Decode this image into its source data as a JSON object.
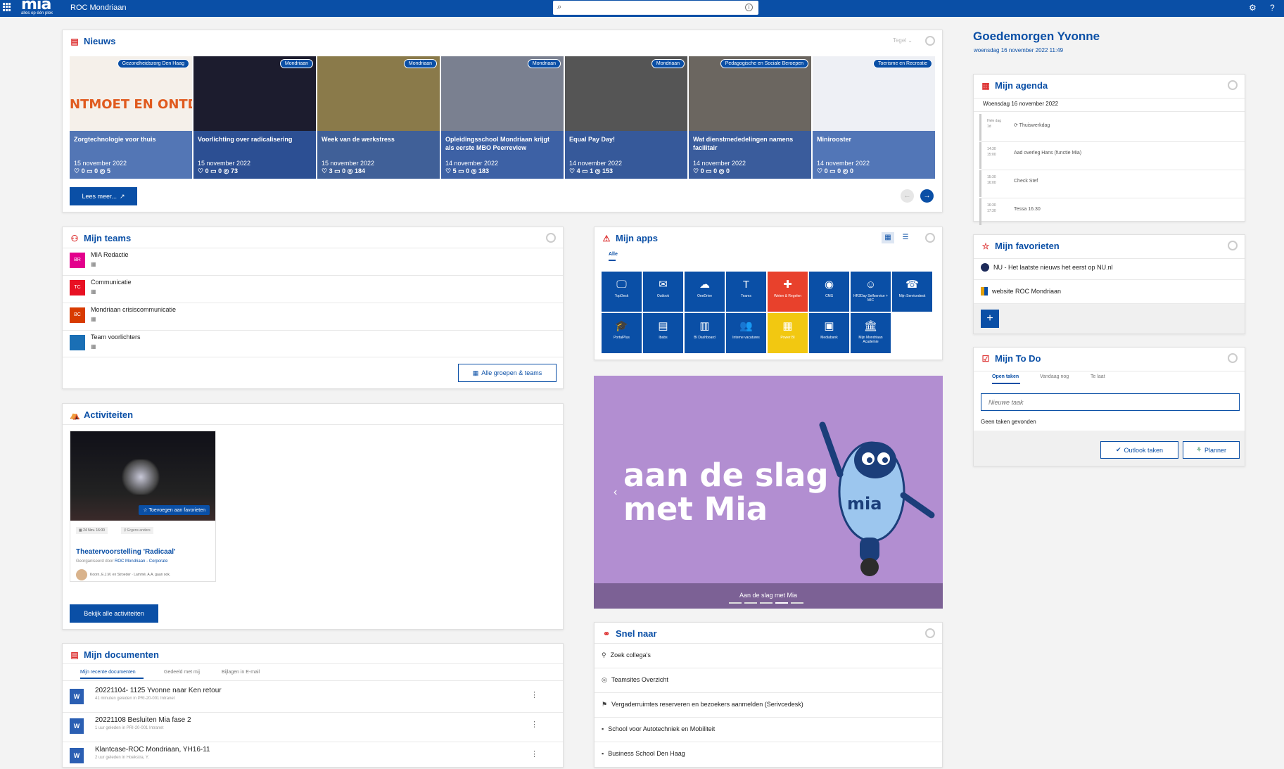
{
  "topbar": {
    "logo_text": "mia",
    "logo_sub": "alles op één plek",
    "org": "ROC Mondriaan",
    "search_placeholder": ""
  },
  "nieuws": {
    "title": "Nieuws",
    "view_label": "Tegel",
    "read_more": "Lees meer...",
    "items": [
      {
        "tag": "Gezondheidszorg Den Haag",
        "title": "Zorgtechnologie voor thuis",
        "date": "15 november 2022",
        "stats": "♡ 0 ▭ 0 ◎ 5",
        "bg": "#f5f0ea",
        "banner": "NTMOET EN ONTD"
      },
      {
        "tag": "Mondriaan",
        "title": "Voorlichting over radicalisering",
        "date": "15 november 2022",
        "stats": "♡ 0 ▭ 0 ◎ 73",
        "bg": "#1c1c2e"
      },
      {
        "tag": "Mondriaan",
        "title": "Week van de werkstress",
        "date": "15 november 2022",
        "stats": "♡ 3 ▭ 0 ◎ 184",
        "bg": "#8a7a4a"
      },
      {
        "tag": "Mondriaan",
        "title": "Opleidingsschool Mondriaan krijgt als eerste MBO Peerreview",
        "date": "14 november 2022",
        "stats": "♡ 5 ▭ 0 ◎ 183",
        "bg": "#7a8090"
      },
      {
        "tag": "Mondriaan",
        "title": "Equal Pay Day!",
        "date": "14 november 2022",
        "stats": "♡ 4 ▭ 1 ◎ 153",
        "bg": "#555555"
      },
      {
        "tag": "Pedagogische en Sociale Beroepen",
        "title": "Wat dienstmededelingen namens facilitair",
        "date": "14 november 2022",
        "stats": "♡ 0 ▭ 0 ◎ 0",
        "bg": "#6b6660"
      },
      {
        "tag": "Toerisme en Recreatie",
        "title": "Minirooster",
        "date": "14 november 2022",
        "stats": "♡ 0 ▭ 0 ◎ 0",
        "bg": "#eef0f5"
      }
    ]
  },
  "greeting": {
    "title": "Goedemorgen Yvonne",
    "date": "woensdag 16 november 2022 11:49"
  },
  "agenda": {
    "title": "Mijn agenda",
    "day": "Woensdag 16 november 2022",
    "events": [
      {
        "time": "Hele dag\n1d",
        "label": "⟳  Thuiswerkdag"
      },
      {
        "time": "14:30\n15:00",
        "label": "Aad overleg Hans (functie Mia)"
      },
      {
        "time": "15:30\n16:00",
        "label": "Check Stef"
      },
      {
        "time": "16:30\n17:30",
        "label": "Tessa 16.30"
      }
    ]
  },
  "teams": {
    "title": "Mijn teams",
    "all_button": "Alle groepen & teams",
    "items": [
      {
        "initials": "BR",
        "name": "MIA Redactie",
        "color": "#e3008c"
      },
      {
        "initials": "TC",
        "name": "Communicatie",
        "color": "#e81123"
      },
      {
        "initials": "BC",
        "name": "Mondriaan crisiscommunicatie",
        "color": "#d83b01"
      },
      {
        "initials": "",
        "name": "Team voorlichters",
        "color": "#1a6fb5"
      }
    ]
  },
  "apps": {
    "title": "Mijn apps",
    "filter": "Alle",
    "items": [
      {
        "label": "TopDesk",
        "color": "#0a4fa6",
        "icon": "🖵"
      },
      {
        "label": "Outlook",
        "color": "#0a4fa6",
        "icon": "✉"
      },
      {
        "label": "OneDrive",
        "color": "#0a4fa6",
        "icon": "☁"
      },
      {
        "label": "Teams",
        "color": "#0a4fa6",
        "icon": "T"
      },
      {
        "label": "Weten & Regelen",
        "color": "#e8412c",
        "icon": "✚"
      },
      {
        "label": "CMS",
        "color": "#0a4fa6",
        "icon": "◉"
      },
      {
        "label": "HR2Day Selfservice + MIC",
        "color": "#0a4fa6",
        "icon": "☺"
      },
      {
        "label": "Mijn Servicedesk",
        "color": "#0a4fa6",
        "icon": "☎"
      },
      {
        "label": "PortalPlus",
        "color": "#0a4fa6",
        "icon": "🎓"
      },
      {
        "label": "Ibabs",
        "color": "#0a4fa6",
        "icon": "▤"
      },
      {
        "label": "BI Dashboard",
        "color": "#0a4fa6",
        "icon": "▥"
      },
      {
        "label": "Interne vacatures",
        "color": "#0a4fa6",
        "icon": "👥"
      },
      {
        "label": "Power BI",
        "color": "#f2c811",
        "icon": "▦"
      },
      {
        "label": "Mediabank",
        "color": "#0a4fa6",
        "icon": "▣"
      },
      {
        "label": "Mijn Mondriaan Academie",
        "color": "#0a4fa6",
        "icon": "🏛"
      }
    ]
  },
  "favorieten": {
    "title": "Mijn favorieten",
    "items": [
      "NU - Het laatste nieuws het eerst op NU.nl",
      "website ROC Mondriaan"
    ]
  },
  "todo": {
    "title": "Mijn To Do",
    "tabs": [
      "Open taken",
      "Vandaag nog",
      "Te laat"
    ],
    "placeholder": "Nieuwe taak",
    "empty": "Geen taken gevonden",
    "outlook_btn": "Outlook taken",
    "planner_btn": "Planner"
  },
  "banner": {
    "headline_1": "aan de slag",
    "headline_2": "met Mia",
    "caption": "Aan de slag met Mia",
    "mascot_text": "mia"
  },
  "activiteiten": {
    "title": "Activiteiten",
    "fav_btn": "☆ Toevoegen aan favorieten",
    "date_small": "24 Nov. 16:00",
    "location": "Ergens anders",
    "event_title": "Theatervoorstelling 'Radicaal'",
    "org_prefix": "Georganiseerd door",
    "org_name": "ROC Mondriaan - Corporate",
    "attendees": "Koorn, E.J.M. en Stroeder · Lammé, A.A. gaan ook.",
    "all_btn": "Bekijk alle activiteiten"
  },
  "documenten": {
    "title": "Mijn documenten",
    "tabs": [
      "Mijn recente documenten",
      "Gedeeld met mij",
      "Bijlagen in E-mail"
    ],
    "items": [
      {
        "name": "20221104- 1125 Yvonne naar Ken retour",
        "meta": "41 minuten geleden in PRI-20-001 Intranet"
      },
      {
        "name": "20221108 Besluiten Mia fase 2",
        "meta": "1 uur geleden in PRI-20-001 Intranet"
      },
      {
        "name": "Klantcase-ROC Mondriaan, YH16-11",
        "meta": "2 uur geleden in Hoekstra, Y."
      }
    ]
  },
  "snel": {
    "title": "Snel naar",
    "items": [
      {
        "icon": "⚲",
        "label": "Zoek collega's"
      },
      {
        "icon": "◎",
        "label": "Teamsites Overzicht"
      },
      {
        "icon": "⚑",
        "label": "Vergaderruimtes reserveren en bezoekers aanmelden (Serivcedesk)"
      },
      {
        "icon": "▪",
        "label": "School voor Autotechniek en Mobiliteit"
      },
      {
        "icon": "▪",
        "label": "Business School Den Haag"
      }
    ]
  }
}
